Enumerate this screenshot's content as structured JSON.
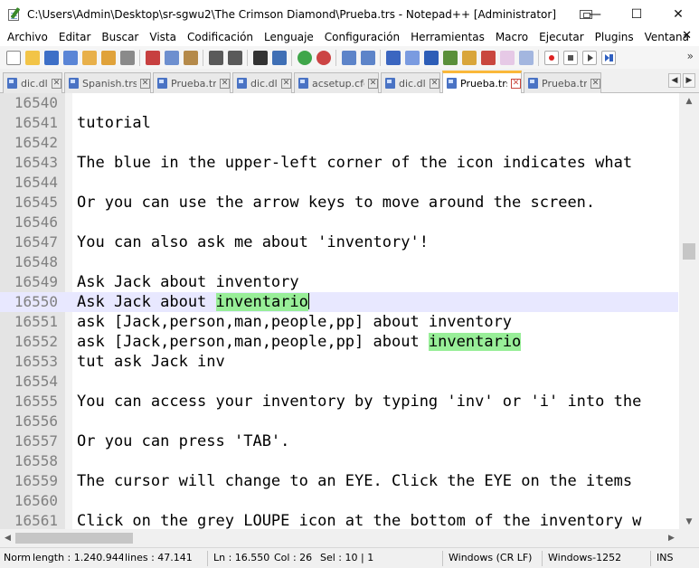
{
  "window": {
    "title": "C:\\Users\\Admin\\Desktop\\sr-sgwu2\\The Crimson Diamond\\Prueba.trs - Notepad++ [Administrator]",
    "minimize": "—",
    "maximize": "☐",
    "close": "✕"
  },
  "menu": {
    "items": [
      "Archivo",
      "Editar",
      "Buscar",
      "Vista",
      "Codificación",
      "Lenguaje",
      "Configuración",
      "Herramientas",
      "Macro",
      "Ejecutar",
      "Plugins",
      "Ventana",
      "?"
    ],
    "close_doc": "✕"
  },
  "toolbar": {
    "icons": [
      "new-file-icon",
      "open-file-icon",
      "save-icon",
      "save-all-icon",
      "close-icon",
      "close-all-icon",
      "print-icon",
      "cut-icon",
      "copy-icon",
      "paste-icon",
      "undo-icon",
      "redo-icon",
      "find-icon",
      "replace-icon",
      "zoom-in-icon",
      "zoom-out-icon",
      "sync-vertical-icon",
      "sync-horizontal-icon",
      "word-wrap-icon",
      "show-all-chars-icon",
      "indent-guide-icon",
      "document-map-icon",
      "function-list-icon",
      "folder-workspace-icon",
      "monitoring-icon",
      "record-macro-icon",
      "stop-record-icon",
      "play-macro-icon",
      "run-macro-multiple-icon"
    ],
    "more": "»"
  },
  "tabs": [
    {
      "label": "dic.dll",
      "active": false,
      "icon": "blue"
    },
    {
      "label": "Spanish.trs",
      "active": false,
      "icon": "blue"
    },
    {
      "label": "Prueba.trs",
      "active": false,
      "icon": "blue"
    },
    {
      "label": "dic.dll",
      "active": false,
      "icon": "blue"
    },
    {
      "label": "acsetup.cfg",
      "active": false,
      "icon": "blue"
    },
    {
      "label": "dic.dll",
      "active": false,
      "icon": "blue"
    },
    {
      "label": "Prueba.trs",
      "active": true,
      "icon": "blue"
    },
    {
      "label": "Prueba.tra",
      "active": false,
      "icon": "blue"
    }
  ],
  "tab_close": "✕",
  "tab_nav": {
    "left": "◀",
    "right": "▶"
  },
  "editor": {
    "lines": [
      {
        "n": "16540",
        "text": ""
      },
      {
        "n": "16541",
        "text": "tutorial"
      },
      {
        "n": "16542",
        "text": ""
      },
      {
        "n": "16543",
        "text": "The blue in the upper-left corner of the icon indicates what"
      },
      {
        "n": "16544",
        "text": ""
      },
      {
        "n": "16545",
        "text": "Or you can use the arrow keys to move around the screen."
      },
      {
        "n": "16546",
        "text": ""
      },
      {
        "n": "16547",
        "text": "You can also ask me about 'inventory'!"
      },
      {
        "n": "16548",
        "text": ""
      },
      {
        "n": "16549",
        "text": "Ask Jack about inventory"
      },
      {
        "n": "16550",
        "text": "Ask Jack about ",
        "highlight": "inventario",
        "current": true
      },
      {
        "n": "16551",
        "text": "ask [Jack,person,man,people,pp] about inventory"
      },
      {
        "n": "16552",
        "text": "ask [Jack,person,man,people,pp] about ",
        "highlight": "inventario"
      },
      {
        "n": "16553",
        "text": "tut ask Jack inv"
      },
      {
        "n": "16554",
        "text": ""
      },
      {
        "n": "16555",
        "text": "You can access your inventory by typing 'inv' or 'i' into the"
      },
      {
        "n": "16556",
        "text": ""
      },
      {
        "n": "16557",
        "text": "Or you can press 'TAB'."
      },
      {
        "n": "16558",
        "text": ""
      },
      {
        "n": "16559",
        "text": "The cursor will change to an EYE. Click the EYE on the items"
      },
      {
        "n": "16560",
        "text": ""
      },
      {
        "n": "16561",
        "text": "Click on the grey LOUPE icon at the bottom of the inventory w"
      }
    ]
  },
  "scroll": {
    "up": "▲",
    "down": "▼",
    "left": "◀",
    "right": "▶"
  },
  "status": {
    "mode": "Norm",
    "length": "length : 1.240.944",
    "lines": "lines : 47.141",
    "ln": "Ln : 16.550",
    "col": "Col : 26",
    "sel": "Sel : 10 | 1",
    "eol": "Windows (CR LF)",
    "encoding": "Windows-1252",
    "ins": "INS"
  },
  "colors": {
    "find_highlight": "#98ee98",
    "current_line": "#e8e8ff",
    "active_tab_accent": "#fab83a"
  }
}
